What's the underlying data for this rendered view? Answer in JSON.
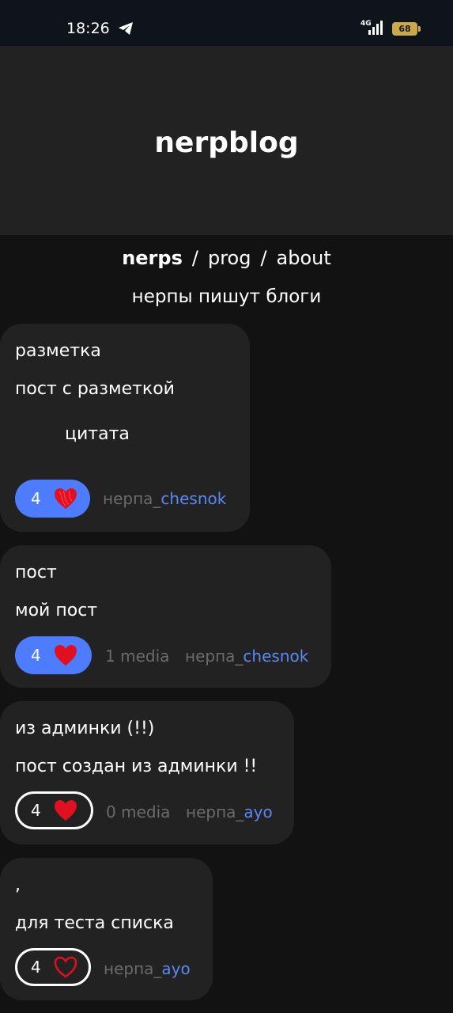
{
  "status_bar": {
    "time": "18:26",
    "network": "4G",
    "battery": "68",
    "icons": [
      "telegram-icon",
      "signal-icon",
      "battery-icon"
    ]
  },
  "header": {
    "title": "nerpblog"
  },
  "nav": {
    "items": [
      {
        "label": "nerps",
        "active": true
      },
      {
        "label": "prog",
        "active": false
      },
      {
        "label": "about",
        "active": false
      }
    ],
    "separator": "/"
  },
  "tagline": "нерпы пишут блоги",
  "posts": [
    {
      "title": "разметка",
      "body": "пост с разметкой",
      "quote": "цитата",
      "likes": "4",
      "liked": true,
      "media": "",
      "author_prefix": "нерпа_",
      "author_name": "chesnok"
    },
    {
      "title": "пост",
      "body": "мой пост",
      "likes": "4",
      "liked": true,
      "media": "1 media",
      "author_prefix": "нерпа_",
      "author_name": "chesnok"
    },
    {
      "title": "из админки (!!)",
      "body": "пост создан из админки !!",
      "likes": "4",
      "liked": false,
      "media": "0 media",
      "author_prefix": "нерпа_",
      "author_name": "ayo"
    },
    {
      "title": ",",
      "body": "для теста списка",
      "likes": "4",
      "liked": false,
      "media": "",
      "author_prefix": "нерпа_",
      "author_name": "ayo"
    }
  ],
  "colors": {
    "background": "#121212",
    "card": "#222222",
    "accent": "#4d7cff",
    "heart": "#e01020",
    "author_name": "#5a88f0",
    "muted": "#6b6b6b"
  }
}
